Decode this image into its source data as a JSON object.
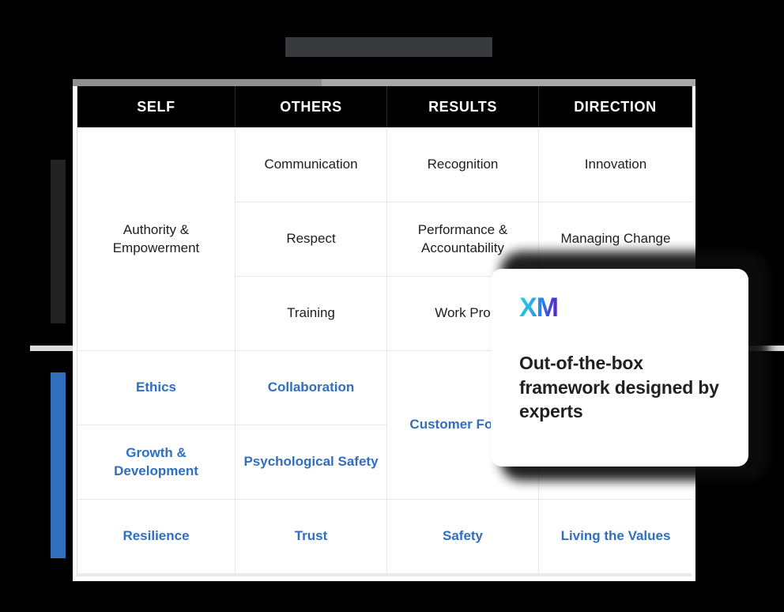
{
  "header": {
    "title_placeholder": ""
  },
  "axis_labels": {
    "top": "",
    "bottom": ""
  },
  "table": {
    "columns": [
      "SELF",
      "OTHERS",
      "RESULTS",
      "DIRECTION"
    ],
    "top_section": {
      "self": "Authority & Empowerment",
      "rows": [
        [
          "Communication",
          "Recognition",
          "Innovation"
        ],
        [
          "Respect",
          "Performance & Accountability",
          "Managing Change"
        ],
        [
          "Training",
          "Work Pro",
          ""
        ]
      ]
    },
    "bottom_section": {
      "rows": [
        [
          "Ethics",
          "Collaboration",
          "Customer Focus",
          ""
        ],
        [
          "Growth & Development",
          "Psychological Safety",
          "",
          ""
        ],
        [
          "Resilience",
          "Trust",
          "Safety",
          "Living the Values"
        ]
      ]
    }
  },
  "overlay_card": {
    "logo": "XM",
    "headline": "Out-of-the-box framework designed by experts"
  },
  "colors": {
    "accent_blue": "#2f6fbe",
    "header_bg": "#000000",
    "placeholder_gray": "#37393d",
    "divider_gray": "#dcdcdc",
    "scroll_track": "#a8a8a8"
  }
}
